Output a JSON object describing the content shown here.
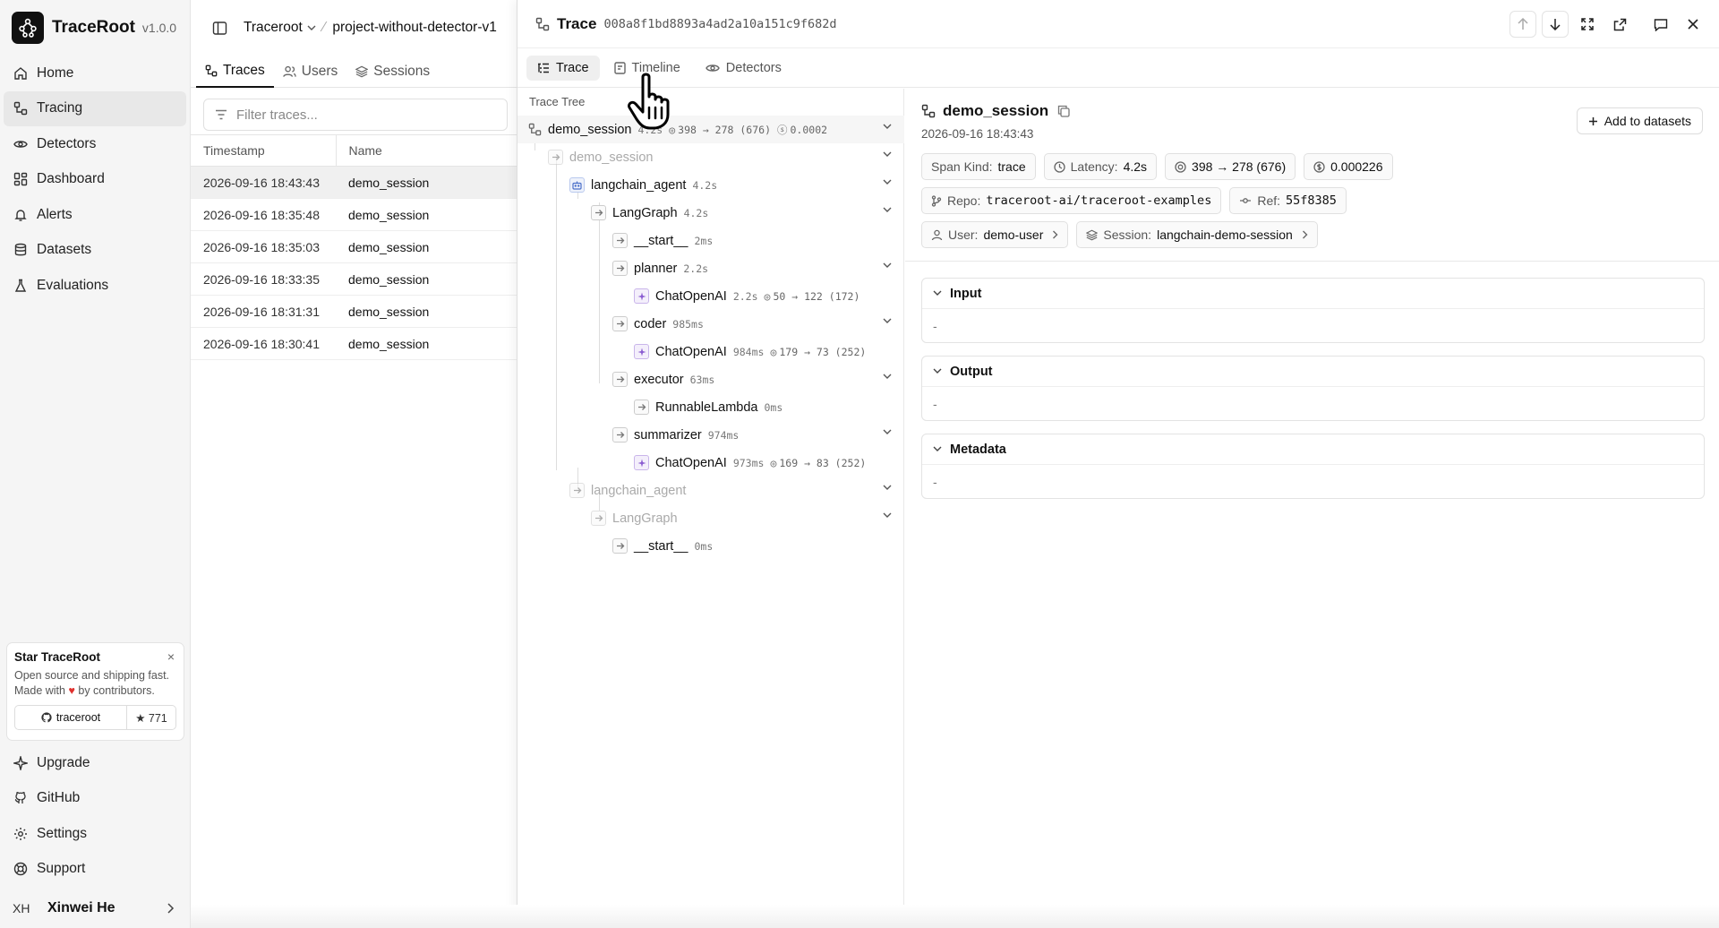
{
  "app": {
    "name": "TraceRoot",
    "version": "v1.0.0"
  },
  "sidebar": {
    "items": [
      {
        "label": "Home",
        "icon": "home-icon"
      },
      {
        "label": "Tracing",
        "icon": "tracing-icon",
        "active": true
      },
      {
        "label": "Detectors",
        "icon": "eye-icon"
      },
      {
        "label": "Dashboard",
        "icon": "dashboard-icon"
      },
      {
        "label": "Alerts",
        "icon": "bell-icon"
      },
      {
        "label": "Datasets",
        "icon": "database-icon"
      },
      {
        "label": "Evaluations",
        "icon": "flask-icon"
      }
    ],
    "star_card": {
      "title": "Star TraceRoot",
      "desc_line1": "Open source and shipping fast.",
      "desc_before": "Made with",
      "desc_after": "by contributors.",
      "repo_label": "traceroot",
      "star_count": "★ 771",
      "close": "×"
    },
    "bottom_items": [
      {
        "label": "Upgrade",
        "icon": "sparkle-icon"
      },
      {
        "label": "GitHub",
        "icon": "github-icon"
      },
      {
        "label": "Settings",
        "icon": "gear-icon"
      },
      {
        "label": "Support",
        "icon": "lifebuoy-icon"
      }
    ],
    "user": {
      "initials": "XH",
      "name": "Xinwei He"
    }
  },
  "header": {
    "org": "Traceroot",
    "project": "project-without-detector-v1"
  },
  "traces_panel": {
    "tabs": [
      {
        "label": "Traces",
        "active": true
      },
      {
        "label": "Users"
      },
      {
        "label": "Sessions"
      }
    ],
    "filter_placeholder": "Filter traces...",
    "columns": [
      "Timestamp",
      "Name"
    ],
    "rows": [
      {
        "timestamp": "2026-09-16 18:43:43",
        "name": "demo_session",
        "selected": true
      },
      {
        "timestamp": "2026-09-16 18:35:48",
        "name": "demo_session"
      },
      {
        "timestamp": "2026-09-16 18:35:03",
        "name": "demo_session"
      },
      {
        "timestamp": "2026-09-16 18:33:35",
        "name": "demo_session"
      },
      {
        "timestamp": "2026-09-16 18:31:31",
        "name": "demo_session"
      },
      {
        "timestamp": "2026-09-16 18:30:41",
        "name": "demo_session"
      }
    ]
  },
  "drawer": {
    "title": "Trace",
    "trace_id": "008a8f1bd8893a4ad2a10a151c9f682d",
    "tabs": [
      {
        "label": "Trace",
        "active": true
      },
      {
        "label": "Timeline"
      },
      {
        "label": "Detectors"
      }
    ],
    "tree_label": "Trace Tree",
    "tree": [
      {
        "name": "demo_session",
        "duration": "4.2s",
        "tokens": "398 → 278 (676)",
        "cost": "0.0002",
        "kind": "root",
        "collapsible": true
      },
      {
        "name": "demo_session",
        "kind": "span",
        "faded": true,
        "collapsible": true
      },
      {
        "name": "langchain_agent",
        "duration": "4.2s",
        "kind": "agent",
        "collapsible": true
      },
      {
        "name": "LangGraph",
        "duration": "4.2s",
        "kind": "span",
        "collapsible": true
      },
      {
        "name": "__start__",
        "duration": "2ms",
        "kind": "span"
      },
      {
        "name": "planner",
        "duration": "2.2s",
        "kind": "span",
        "collapsible": true
      },
      {
        "name": "ChatOpenAI",
        "duration": "2.2s",
        "tokens": "50 → 122 (172)",
        "kind": "llm"
      },
      {
        "name": "coder",
        "duration": "985ms",
        "kind": "span",
        "collapsible": true
      },
      {
        "name": "ChatOpenAI",
        "duration": "984ms",
        "tokens": "179 → 73 (252)",
        "kind": "llm"
      },
      {
        "name": "executor",
        "duration": "63ms",
        "kind": "span",
        "collapsible": true
      },
      {
        "name": "RunnableLambda",
        "duration": "0ms",
        "kind": "span"
      },
      {
        "name": "summarizer",
        "duration": "974ms",
        "kind": "span",
        "collapsible": true
      },
      {
        "name": "ChatOpenAI",
        "duration": "973ms",
        "tokens": "169 → 83 (252)",
        "kind": "llm"
      },
      {
        "name": "langchain_agent",
        "kind": "span",
        "faded": true,
        "collapsible": true
      },
      {
        "name": "LangGraph",
        "kind": "span",
        "faded": true,
        "collapsible": true
      },
      {
        "name": "__start__",
        "duration": "0ms",
        "kind": "span"
      }
    ],
    "detail": {
      "name": "demo_session",
      "time": "2026-09-16 18:43:43",
      "add_button": "Add to datasets",
      "span_kind_label": "Span Kind:",
      "span_kind": "trace",
      "latency_label": "Latency:",
      "latency": "4.2s",
      "tokens": "398 → 278 (676)",
      "cost": "0.000226",
      "repo_label": "Repo:",
      "repo": "traceroot-ai/traceroot-examples",
      "ref_label": "Ref:",
      "ref": "55f8385",
      "user_label": "User:",
      "user": "demo-user",
      "session_label": "Session:",
      "session": "langchain-demo-session",
      "sections": [
        {
          "title": "Input",
          "value": "-"
        },
        {
          "title": "Output",
          "value": "-"
        },
        {
          "title": "Metadata",
          "value": "-"
        }
      ]
    }
  }
}
